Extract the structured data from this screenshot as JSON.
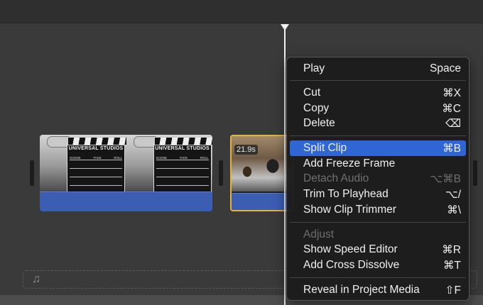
{
  "timeline": {
    "clip1": {
      "clapper_title": "UNIVERSAL STUDIOS",
      "row_labels": [
        "SCENE",
        "TAKE",
        "ROLL"
      ]
    },
    "clip2": {
      "duration": "21.9s"
    },
    "music_icon": "music-note-icon"
  },
  "context_menu": {
    "play": {
      "label": "Play",
      "shortcut": "Space"
    },
    "cut": {
      "label": "Cut",
      "shortcut": "⌘X"
    },
    "copy": {
      "label": "Copy",
      "shortcut": "⌘C"
    },
    "delete": {
      "label": "Delete",
      "shortcut": "⌫"
    },
    "split_clip": {
      "label": "Split Clip",
      "shortcut": "⌘B"
    },
    "add_freeze_frame": {
      "label": "Add Freeze Frame",
      "shortcut": ""
    },
    "detach_audio": {
      "label": "Detach Audio",
      "shortcut": "⌥⌘B"
    },
    "trim_to_playhead": {
      "label": "Trim To Playhead",
      "shortcut": "⌥/"
    },
    "show_clip_trimmer": {
      "label": "Show Clip Trimmer",
      "shortcut": "⌘\\"
    },
    "adjust_header": "Adjust",
    "show_speed_editor": {
      "label": "Show Speed Editor",
      "shortcut": "⌘R"
    },
    "add_cross_dissolve": {
      "label": "Add Cross Dissolve",
      "shortcut": "⌘T"
    },
    "reveal_in_project_media": {
      "label": "Reveal in Project Media",
      "shortcut": "⇧F"
    }
  },
  "colors": {
    "highlight": "#2f66d4",
    "audio_strip": "#3b5db2",
    "selected_clip_border": "#e3b43a"
  }
}
